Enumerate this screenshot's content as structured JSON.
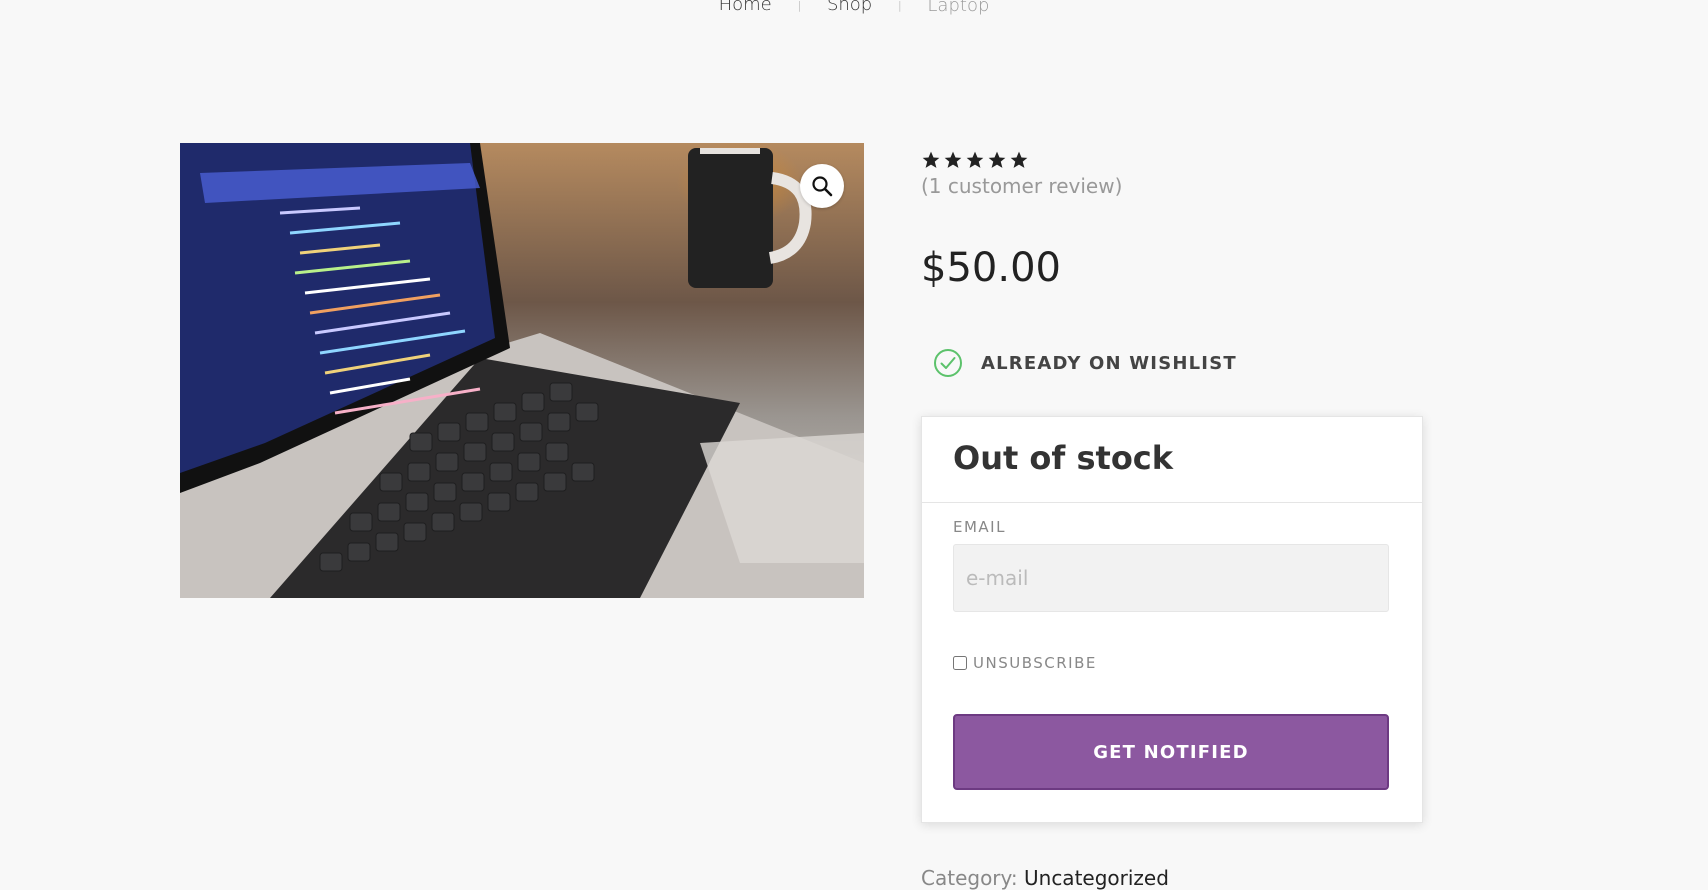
{
  "breadcrumb": {
    "items": [
      {
        "label": "Home"
      },
      {
        "label": "Shop"
      },
      {
        "label": "Laptop"
      }
    ]
  },
  "product": {
    "image_icon": "laptop-photo",
    "zoom_icon": "magnifier-icon",
    "rating_value": 5,
    "rating_max": 5,
    "review_text": "(1 customer review)",
    "price": "$50.00",
    "wishlist_label": "ALREADY ON WISHLIST",
    "category_label": "Category:",
    "category_value": "Uncategorized"
  },
  "stock_box": {
    "title": "Out of stock",
    "email_label": "EMAIL",
    "email_placeholder": "e-mail",
    "email_value": "",
    "unsubscribe_label": "UNSUBSCRIBE",
    "unsubscribe_checked": false,
    "button_label": "GET NOTIFIED"
  },
  "colors": {
    "background": "#f8f8f8",
    "button": "#8c58a0",
    "button_border": "#6d3a82",
    "check_icon": "#5cc26b",
    "stars": "#222222"
  }
}
